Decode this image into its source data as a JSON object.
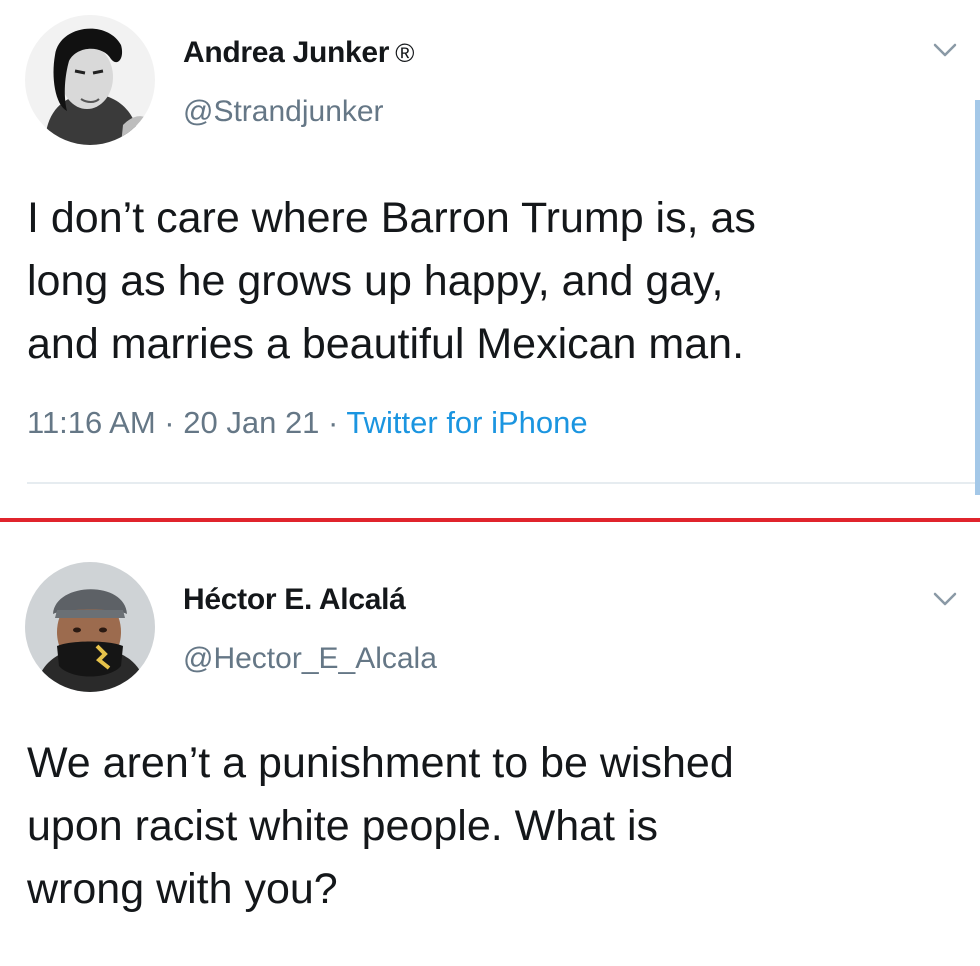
{
  "tweets": [
    {
      "display_name": "Andrea Junker",
      "display_name_mark": "®",
      "handle": "@Strandjunker",
      "text": "I don’t care where Barron Trump is, as\nlong as he grows up happy, and gay,\nand marries a beautiful Mexican man.",
      "time": "11:16 AM",
      "separator": " · ",
      "date": "20 Jan 21",
      "source": "Twitter for iPhone",
      "avatar_icon": "avatar-woman-bw",
      "menu_icon": "chevron-down-icon"
    },
    {
      "display_name": "Héctor E. Alcalá",
      "handle": "@Hector_E_Alcala",
      "text": "We aren’t a punishment to be wished\nupon racist white people. What is\nwrong with you?",
      "avatar_icon": "avatar-man-masked",
      "menu_icon": "chevron-down-icon"
    }
  ],
  "colors": {
    "text": "#14171a",
    "secondary": "#657786",
    "link": "#1b95e0",
    "separator": "#e0242c",
    "divider": "#e6ecf0"
  }
}
